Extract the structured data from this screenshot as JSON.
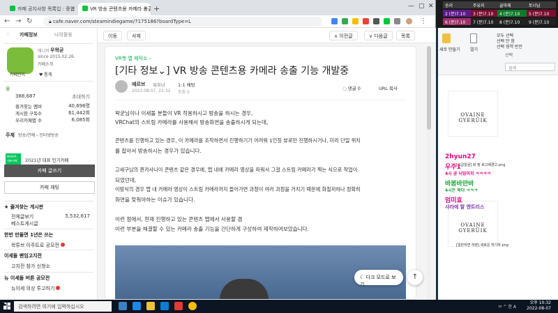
{
  "browser": {
    "tabs": [
      {
        "label": "카페 공지사항 목록입 : 중입"
      },
      {
        "label": "VR 방송 콘텐츠용 카메라 송출"
      }
    ],
    "url": "cafe.naver.com/steamindiegame/7175186?boardType=L"
  },
  "topbar": {
    "move": "이동",
    "delete": "삭제",
    "prev": "∧ 이전글",
    "next": "∨ 다음글",
    "list": "목록"
  },
  "sidebar": {
    "tab_cafe": "카페정보",
    "tab_activity": "나의활동",
    "manager_label": "매니저",
    "manager_name": "우왁굳",
    "since": "since 2015.02.26.",
    "intro": "카페소개",
    "cafe_manage": "카페관리",
    "invite": "♥ 통계",
    "grade_icon": "숲",
    "members": "388,687",
    "invite_label": "초대하기",
    "fav_members_label": "즐겨찾는 멤버",
    "fav_members": "40,696명",
    "board_sub_label": "게시판 구독수",
    "board_sub": "61,442회",
    "store_label": "우리카페앱 수",
    "store": "6,085회",
    "subject": "주제",
    "subject_val": "방송/연예 › 인터넷방송",
    "badge1": "NAVER 대표카페",
    "badge_text": "2021년 대표 인기카페",
    "write_btn": "카페 글쓰기",
    "chat_btn": "카페 채팅",
    "fav_boards": "★ 즐겨찾는 게시판",
    "all_posts": "전체글보기",
    "all_count": "5,532,617",
    "best": "베스트게시글",
    "sec2": "한번 만들면 1년은 쓰는",
    "sec2_item": "왁튜브 이주트로 공모전",
    "sec3": "이세돌 팬임고지전",
    "sec3_item": "고지전 참가 신청소",
    "sec4": "뉴 이세돌 버튼 공모전",
    "sec4_item": "뉴이세 의상 투고하기"
  },
  "article": {
    "board": "VR챗 맵 제작소 ›",
    "title": "[기타 정보⌄] VR 방송 콘텐츠용 카메라 송출 기능 개발중",
    "author": "예르브",
    "author_grade": "워무녀",
    "chat_label": "1:1 채팅",
    "date": "2022.08.07. 22:32",
    "views": "조회 0",
    "comments": "댓글 0",
    "url_copy": "URL 복사",
    "p1": "왁굳님이나 이세돌 분들이 VR 작용하시고 방송을 하시는 경우,",
    "p2": "VRChat의 스트림 카메라를 사용해서 방송화면을 송출하시게 되는데,",
    "p3": "콘텐츠를 진행하고 있는 경우, 이 카메라를 조작하면서 진행하기가 어려워 1인칭 뷰로만 진행하시거나, 미리 단일 위치",
    "p4": "를 잡아서 방송하시는 경우가 있습니다.",
    "p5": "고세구님의 퀸카사니이 콘텐츠 같은 경우에, 맵 내에 카메라 영상을 띄워서 그걸 스트림 카메라가 찍는 식으로 작업이",
    "p6": "되었던데,",
    "p7": "이방식의 경우 맵 내 카메라 영상이 스트림 카메라까지 들어가면 과정이 여러 과정을 거치기 때문에 화질저하나 정확히",
    "p8": "화면을 맞춰야하는 이슈가 있습니다.",
    "p9": "이런 점에서, 현재 진행하고 있는 콘텐츠 맵에서 사용할 겸",
    "p10": "이런 부분을 해결할 수 있는 카메라 송출 기능을 간단하게 구상하여 제작하여보았습니다.",
    "dark_mode": "다크 모드로 보기"
  },
  "desktop": {
    "game_cells": [
      "승리",
      "주유지",
      "골마제",
      "토너님",
      "2 (분)7.10",
      "3 (분)7.10",
      "4 (분)7.10",
      "5 (분)7.10",
      "6 (분)7.10",
      "7 (분)7.10",
      "8 (분)7.10",
      "9 (분)7.10"
    ],
    "ribbon": [
      "새로 만들기",
      "열기",
      "모두 선택",
      "선택 안 함",
      "선택 영역 반전",
      "선택"
    ],
    "search_placeholder": "검색",
    "file1_label": "[고급얼굴] 화 정 로고배경고.png",
    "file2_label": "[일반하면 하렌] 새로운 하기와.png",
    "logo_text": "OVAINE GYERÜIK",
    "chat_lines": [
      {
        "text": "2hyun27",
        "color": "#e4007f"
      },
      {
        "text": "우주1",
        "color": "#e4007f"
      },
      {
        "text": "4시 공 늬밍이지 ㅋㅋㅋㅋ",
        "color": "#e4007f"
      },
      {
        "text": "바봄바만바",
        "color": "#1aa337"
      },
      {
        "text": "4시든 묵다 ㅋㅋㅋ",
        "color": "#1aa337"
      },
      {
        "text": "엄미효",
        "color": "#e4007f"
      },
      {
        "text": "샤라에 랄 엔트리스",
        "color": "#7a3aa8"
      }
    ]
  },
  "taskbar": {
    "search_placeholder": "검색하려면 여기에 입력하십시오",
    "time": "오후 10:32",
    "date": "2022-08-07",
    "tray": "ㅁ ^ 한 A"
  }
}
